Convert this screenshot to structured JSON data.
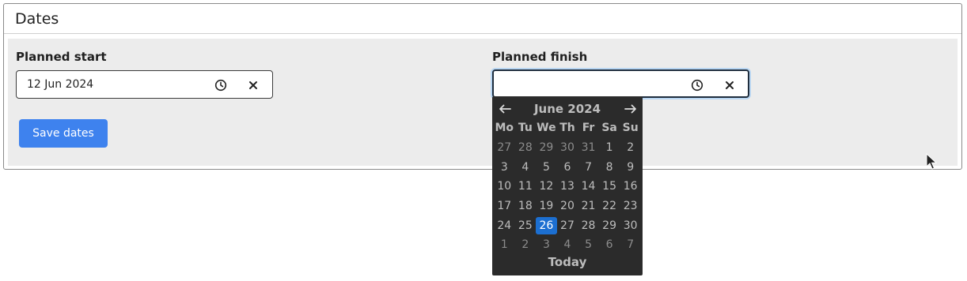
{
  "panel": {
    "title": "Dates"
  },
  "planned_start": {
    "label": "Planned start",
    "value": "12 Jun 2024",
    "placeholder": ""
  },
  "planned_finish": {
    "label": "Planned finish",
    "value": "",
    "placeholder": ""
  },
  "save_button": {
    "label": "Save dates"
  },
  "calendar": {
    "month_title": "June 2024",
    "prev_icon": "arrow-left-icon",
    "next_icon": "arrow-right-icon",
    "weekdays": [
      "Mo",
      "Tu",
      "We",
      "Th",
      "Fr",
      "Sa",
      "Su"
    ],
    "weeks": [
      [
        {
          "d": "27",
          "m": true
        },
        {
          "d": "28",
          "m": true
        },
        {
          "d": "29",
          "m": true
        },
        {
          "d": "30",
          "m": true
        },
        {
          "d": "31",
          "m": true
        },
        {
          "d": "1"
        },
        {
          "d": "2"
        }
      ],
      [
        {
          "d": "3"
        },
        {
          "d": "4"
        },
        {
          "d": "5"
        },
        {
          "d": "6"
        },
        {
          "d": "7"
        },
        {
          "d": "8"
        },
        {
          "d": "9"
        }
      ],
      [
        {
          "d": "10"
        },
        {
          "d": "11"
        },
        {
          "d": "12"
        },
        {
          "d": "13"
        },
        {
          "d": "14"
        },
        {
          "d": "15"
        },
        {
          "d": "16"
        }
      ],
      [
        {
          "d": "17"
        },
        {
          "d": "18"
        },
        {
          "d": "19"
        },
        {
          "d": "20"
        },
        {
          "d": "21"
        },
        {
          "d": "22"
        },
        {
          "d": "23"
        }
      ],
      [
        {
          "d": "24"
        },
        {
          "d": "25"
        },
        {
          "d": "26",
          "s": true
        },
        {
          "d": "27"
        },
        {
          "d": "28"
        },
        {
          "d": "29"
        },
        {
          "d": "30"
        }
      ],
      [
        {
          "d": "1",
          "m": true
        },
        {
          "d": "2",
          "m": true
        },
        {
          "d": "3",
          "m": true
        },
        {
          "d": "4",
          "m": true
        },
        {
          "d": "5",
          "m": true
        },
        {
          "d": "6",
          "m": true
        },
        {
          "d": "7",
          "m": true
        }
      ]
    ],
    "today_label": "Today"
  },
  "colors": {
    "accent": "#3e82ee",
    "selected_day": "#1c6fd1",
    "calendar_bg": "#2b2b2b",
    "panel_body_bg": "#ececec"
  },
  "icons": {
    "clock": "clock-icon",
    "clear": "clear-x-icon"
  }
}
